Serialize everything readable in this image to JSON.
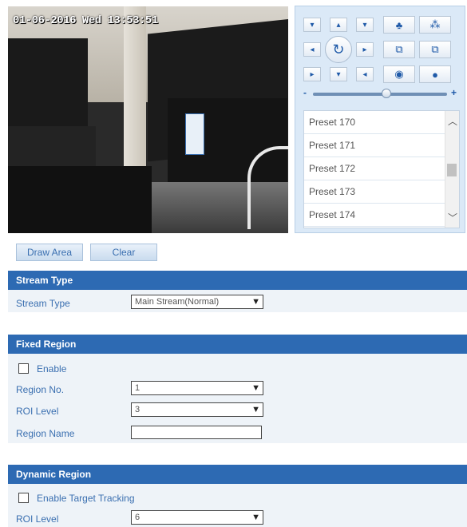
{
  "video": {
    "osd_timestamp": "01-06-2016 Wed 13:53:51"
  },
  "ptz": {
    "icons": {
      "up_left": "arrow-up-left-icon",
      "up": "arrow-up-icon",
      "up_right": "arrow-up-right-icon",
      "left": "arrow-left-icon",
      "center": "auto-rotate-icon",
      "right": "arrow-right-icon",
      "down_left": "arrow-down-left-icon",
      "down": "arrow-down-icon",
      "down_right": "arrow-down-right-icon",
      "zoom_in": "zoom-in-icon",
      "zoom_out": "zoom-out-icon",
      "focus_near": "focus-near-icon",
      "focus_far": "focus-far-icon",
      "iris_open": "iris-open-icon",
      "iris_close": "iris-close-icon"
    },
    "glyphs": {
      "up_left": "▾",
      "up": "▴",
      "up_right": "▾",
      "left": "◂",
      "center": "↻",
      "right": "▸",
      "down_left": "▸",
      "down": "▾",
      "down_right": "◂",
      "zoom_in": "♣",
      "zoom_out": "⁂",
      "focus_near": "⧉",
      "focus_far": "⧉",
      "iris_open": "◉",
      "iris_close": "●"
    },
    "slider": {
      "minus": "-",
      "plus": "+",
      "speed_fraction": 0.55
    },
    "presets": [
      "Preset 170",
      "Preset 171",
      "Preset 172",
      "Preset 173",
      "Preset 174"
    ]
  },
  "toolbar": {
    "draw_area": "Draw Area",
    "clear": "Clear"
  },
  "stream_type": {
    "header": "Stream Type",
    "label": "Stream Type",
    "value": "Main Stream(Normal)"
  },
  "fixed_region": {
    "header": "Fixed Region",
    "enable_label": "Enable",
    "region_no_label": "Region No.",
    "region_no_value": "1",
    "roi_level_label": "ROI Level",
    "roi_level_value": "3",
    "region_name_label": "Region Name",
    "region_name_value": ""
  },
  "dynamic_region": {
    "header": "Dynamic Region",
    "enable_tracking_label": "Enable Target Tracking",
    "roi_level_label": "ROI Level",
    "roi_level_value": "6"
  },
  "colors": {
    "accent": "#2d6ab3",
    "panel": "#dbe9f7",
    "label": "#3a6fb0"
  }
}
